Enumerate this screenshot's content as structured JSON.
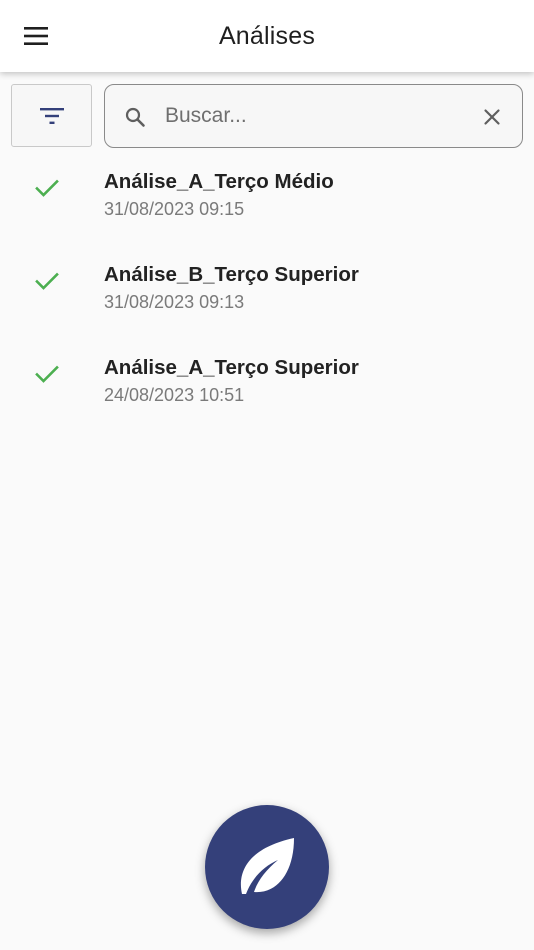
{
  "header": {
    "title": "Análises",
    "menu_icon": "hamburger-menu-icon"
  },
  "toolbar": {
    "filter_icon": "filter-list-icon",
    "search": {
      "placeholder": "Buscar...",
      "value": "",
      "search_icon": "search-icon",
      "clear_icon": "close-icon"
    }
  },
  "analyses": [
    {
      "title": "Análise_A_Terço Médio",
      "date": "31/08/2023 09:15",
      "status_icon": "check-icon"
    },
    {
      "title": "Análise_B_Terço Superior",
      "date": "31/08/2023 09:13",
      "status_icon": "check-icon"
    },
    {
      "title": "Análise_A_Terço Superior",
      "date": "24/08/2023 10:51",
      "status_icon": "check-icon"
    }
  ],
  "fab": {
    "icon": "leaf-icon"
  },
  "colors": {
    "primary": "#34407a",
    "success": "#4caf50",
    "background": "#fafafa"
  }
}
